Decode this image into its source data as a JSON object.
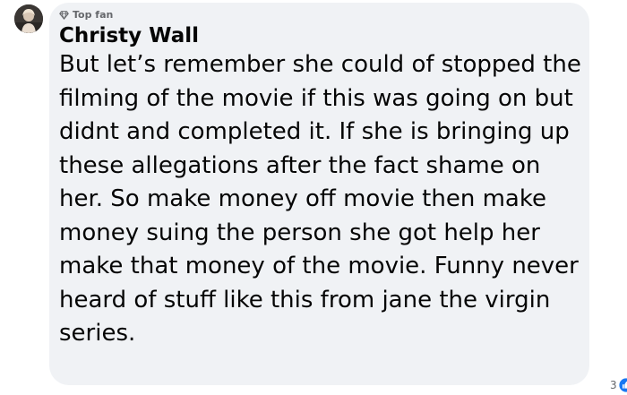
{
  "comment": {
    "badge_label": "Top fan",
    "author": "Christy Wall",
    "text": "But let’s remember she could of stopped the filming of the movie if this was going on but didnt and completed it. If she is bringing up these allegations after the fact shame on her. So make money off movie then make money suing the person she got help her make that money of the movie. Funny never heard of stuff like this from jane the virgin series.",
    "reaction_count": "3",
    "reaction_icon": "like-icon",
    "badge_icon": "diamond-icon"
  },
  "colors": {
    "bubble_background": "#f0f2f5",
    "text": "#050505",
    "secondary_text": "#65676b",
    "like_blue": "#1877f2"
  }
}
